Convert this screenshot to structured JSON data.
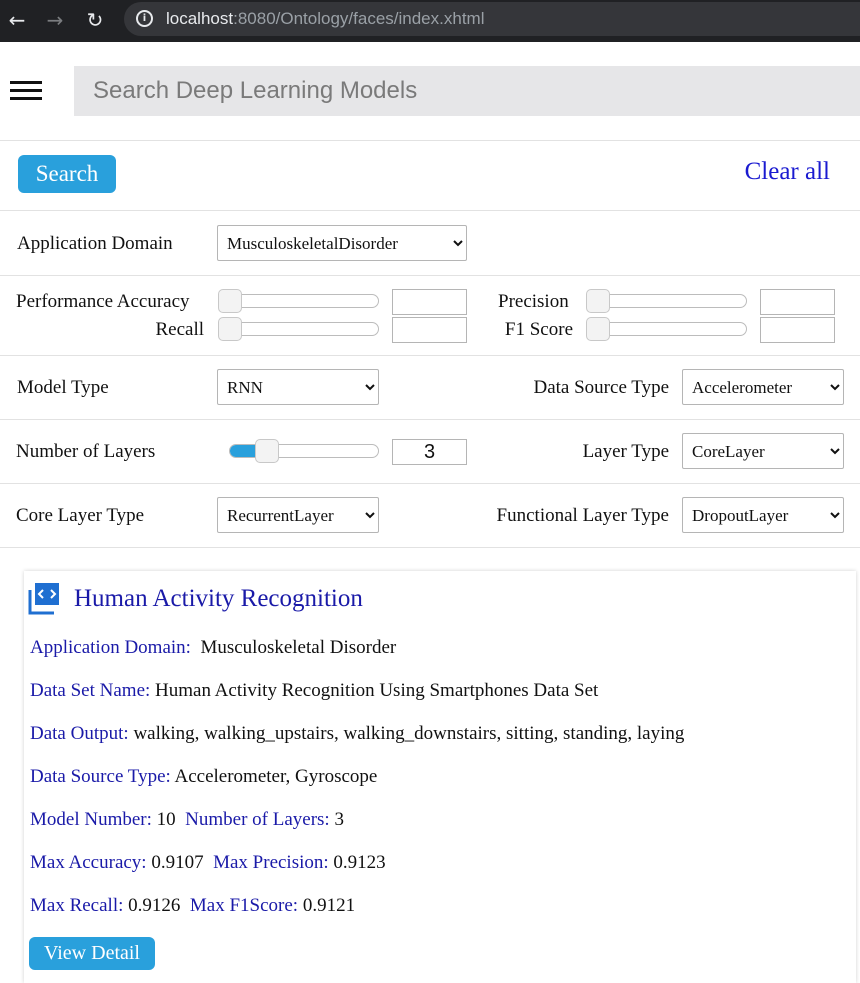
{
  "browser": {
    "back_icon": "arrow-left-icon",
    "forward_icon": "arrow-right-icon",
    "reload_icon": "reload-icon",
    "url_host": "localhost",
    "url_rest": ":8080/Ontology/faces/index.xhtml"
  },
  "header": {
    "menu_icon": "hamburger-icon",
    "search_placeholder": "Search Deep Learning Models"
  },
  "toolbar": {
    "search_label": "Search",
    "clear_label": "Clear all"
  },
  "filters": {
    "application_domain": {
      "label": "Application Domain",
      "value": "MusculoskeletalDisorder"
    },
    "performance_accuracy": {
      "label": "Performance Accuracy",
      "value": ""
    },
    "precision": {
      "label": "Precision",
      "value": ""
    },
    "recall": {
      "label": "Recall",
      "value": ""
    },
    "f1_score": {
      "label": "F1 Score",
      "value": ""
    },
    "model_type": {
      "label": "Model Type",
      "value": "RNN"
    },
    "data_source_type": {
      "label": "Data Source Type",
      "value": "Accelerometer"
    },
    "number_of_layers": {
      "label": "Number of Layers",
      "value": "3",
      "slider_fraction": 0.2
    },
    "layer_type": {
      "label": "Layer Type",
      "value": "CoreLayer"
    },
    "core_layer_type": {
      "label": "Core Layer Type",
      "value": "RecurrentLayer"
    },
    "functional_layer_type": {
      "label": "Functional Layer Type",
      "value": "DropoutLayer"
    }
  },
  "result": {
    "icon": "code-window-icon",
    "title": "Human Activity Recognition",
    "application_domain_key": "Application Domain:",
    "application_domain_value": "Musculoskeletal Disorder",
    "dataset_key": "Data Set Name:",
    "dataset_value": "Human Activity Recognition Using Smartphones Data Set",
    "output_key": "Data Output:",
    "output_value": "walking, walking_upstairs, walking_downstairs, sitting, standing, laying",
    "source_key": "Data Source Type:",
    "source_value": "Accelerometer, Gyroscope",
    "model_number_key": "Model Number:",
    "model_number_value": "10",
    "layers_key": "Number of Layers:",
    "layers_value": "3",
    "max_accuracy_key": "Max Accuracy:",
    "max_accuracy_value": "0.9107",
    "max_precision_key": "Max Precision:",
    "max_precision_value": "0.9123",
    "max_recall_key": "Max Recall:",
    "max_recall_value": "0.9126",
    "max_f1_key": "Max F1Score:",
    "max_f1_value": "0.9121",
    "detail_label": "View Detail"
  },
  "colors": {
    "accent": "#29a0dc",
    "link": "#1a1aa8",
    "browser_bar": "#202124"
  }
}
